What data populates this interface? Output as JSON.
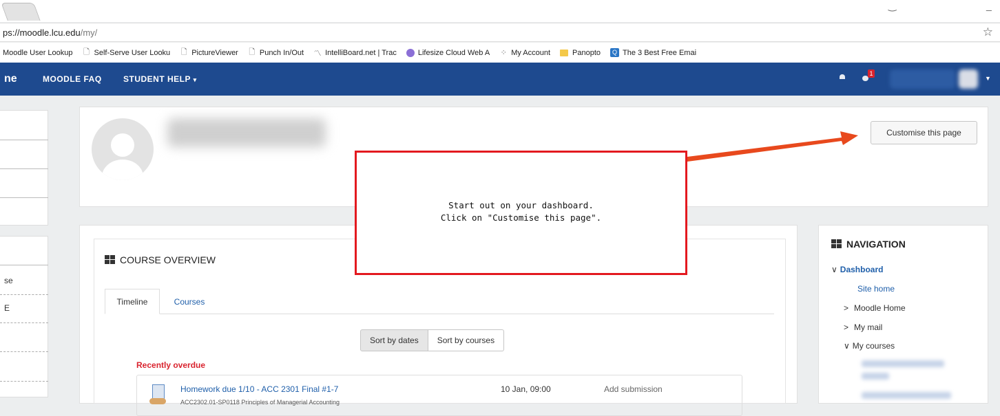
{
  "browser": {
    "address_host": "ps://moodle.lcu.edu",
    "address_path": "/my/",
    "star_icon": "star-icon",
    "bookmarks": [
      {
        "label": "Moodle User Lookup",
        "icon": "none"
      },
      {
        "label": "Self-Serve User Looku",
        "icon": "page-icon"
      },
      {
        "label": "PictureViewer",
        "icon": "page-icon"
      },
      {
        "label": "Punch In/Out",
        "icon": "page-icon"
      },
      {
        "label": "IntelliBoard.net | Trac",
        "icon": "intelliboard-icon"
      },
      {
        "label": "Lifesize Cloud Web A",
        "icon": "lifesize-icon"
      },
      {
        "label": "My Account",
        "icon": "dots-icon"
      },
      {
        "label": "Panopto",
        "icon": "folder-icon"
      },
      {
        "label": "The 3 Best Free Emai",
        "icon": "q-icon"
      }
    ]
  },
  "navbar": {
    "brand": "ne",
    "links": [
      "MOODLE FAQ",
      "STUDENT HELP"
    ],
    "message_badge": "1",
    "bg_color": "#1e4a8f"
  },
  "left_column": {
    "items": [
      "se",
      "E"
    ]
  },
  "profile": {
    "customise_button": "Customise this page"
  },
  "course_overview": {
    "title": "COURSE OVERVIEW",
    "tabs": [
      "Timeline",
      "Courses"
    ],
    "sort_buttons": [
      "Sort by dates",
      "Sort by courses"
    ],
    "section_heading": "Recently overdue",
    "event": {
      "title": "Homework due 1/10 - ACC 2301 Final #1-7",
      "course": "ACC2302.01-SP0118 Principles of Managerial Accounting",
      "date": "10 Jan, 09:00",
      "action": "Add submission"
    }
  },
  "navigation": {
    "title": "NAVIGATION",
    "items": [
      {
        "label": "Dashboard",
        "prefix": "∨"
      },
      {
        "label": "Site home",
        "prefix": ""
      },
      {
        "label": "Moodle Home",
        "prefix": ">"
      },
      {
        "label": "My mail",
        "prefix": ">"
      },
      {
        "label": "My courses",
        "prefix": "∨"
      }
    ]
  },
  "callout": {
    "line1": "Start out on your dashboard.",
    "line2": "Click on \"Customise this page\".",
    "border_color": "#e3191f",
    "arrow_color": "#e8491d"
  }
}
